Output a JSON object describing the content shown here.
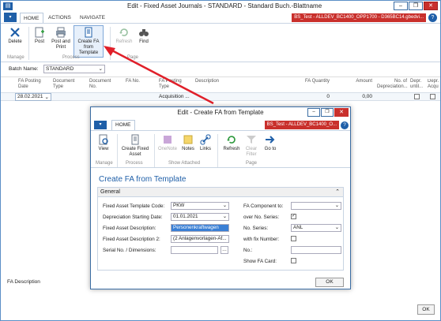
{
  "main": {
    "title": "Edit - Fixed Asset Journals - STANDARD - Standard Buch.-Blattname",
    "file_tab": "▾",
    "tabs": [
      "HOME",
      "ACTIONS",
      "NAVIGATE"
    ],
    "user_badge": "BS_Test - ALLDEV_BC1400_OPP1700 - D365BC14.gbedvi...",
    "help": "?",
    "window_buttons": {
      "minimize": "–",
      "maximize": "❐",
      "close": "✕"
    },
    "ribbon": {
      "delete": "Delete",
      "post": "Post",
      "post_and_print": "Post and Print",
      "create_fa_from_template": "Create FA from Template",
      "refresh": "Refresh",
      "find": "Find",
      "group_manage": "Manage",
      "group_process": "Process",
      "group_page": "Page"
    },
    "batch_name_label": "Batch Name:",
    "batch_name_value": "STANDARD",
    "columns": [
      "FA Posting Date",
      "Document Type",
      "Document No.",
      "FA No.",
      "FA Posting Type",
      "Description",
      "FA Quantity",
      "Amount",
      "No. of Depreciation...",
      "Depr. until...",
      "Depr. Acqu..."
    ],
    "row": {
      "posting_date": "28.02.2021",
      "posting_type": "Acquisition ...",
      "quantity": "0",
      "amount": "0,00"
    },
    "fa_description_label": "FA Description",
    "ok_label": "OK"
  },
  "dialog": {
    "title": "Edit - Create FA from Template",
    "file_tab": "▾",
    "home_tab": "HOME",
    "user_badge": "BS_Test - ALLDEV_BC1400_O...",
    "help": "?",
    "window_buttons": {
      "minimize": "–",
      "maximize": "❐",
      "close": "✕"
    },
    "ribbon": {
      "view": "View",
      "create_fixed_asset": "Create Fixed Asset",
      "onenote": "OneNote",
      "notes": "Notes",
      "links": "Links",
      "refresh": "Refresh",
      "clear_filter": "Clear Filter",
      "go_to": "Go to",
      "group_manage": "Manage",
      "group_process": "Process",
      "group_show_attached": "Show Attached",
      "group_page": "Page"
    },
    "heading": "Create FA from Template",
    "section_title": "General",
    "fields": {
      "template_code_label": "Fixed Asset Template Code:",
      "template_code_value": "PKW",
      "dep_start_label": "Depreciation Starting Date:",
      "dep_start_value": "01.01.2021",
      "fa_desc_label": "Fixed Asset Description:",
      "fa_desc_value": "Personenkraftwagen",
      "fa_desc2_label": "Fixed Asset Description 2:",
      "fa_desc2_value": "(2 Anlagenvorlagen-Af...",
      "serial_label": "Serial No. / Dimensions:",
      "serial_value": "",
      "fa_component_label": "FA Component to:",
      "fa_component_value": "",
      "over_no_series_label": "over No. Series:",
      "no_series_label": "No. Series:",
      "no_series_value": "ANL",
      "with_fix_number_label": "with fix Number:",
      "no_label": "No.:",
      "no_value": "",
      "show_fa_card_label": "Show FA Card:"
    },
    "ok_label": "OK"
  },
  "colors": {
    "accent": "#1f5fa8",
    "danger": "#c9302c",
    "arrow": "#e0202a"
  }
}
